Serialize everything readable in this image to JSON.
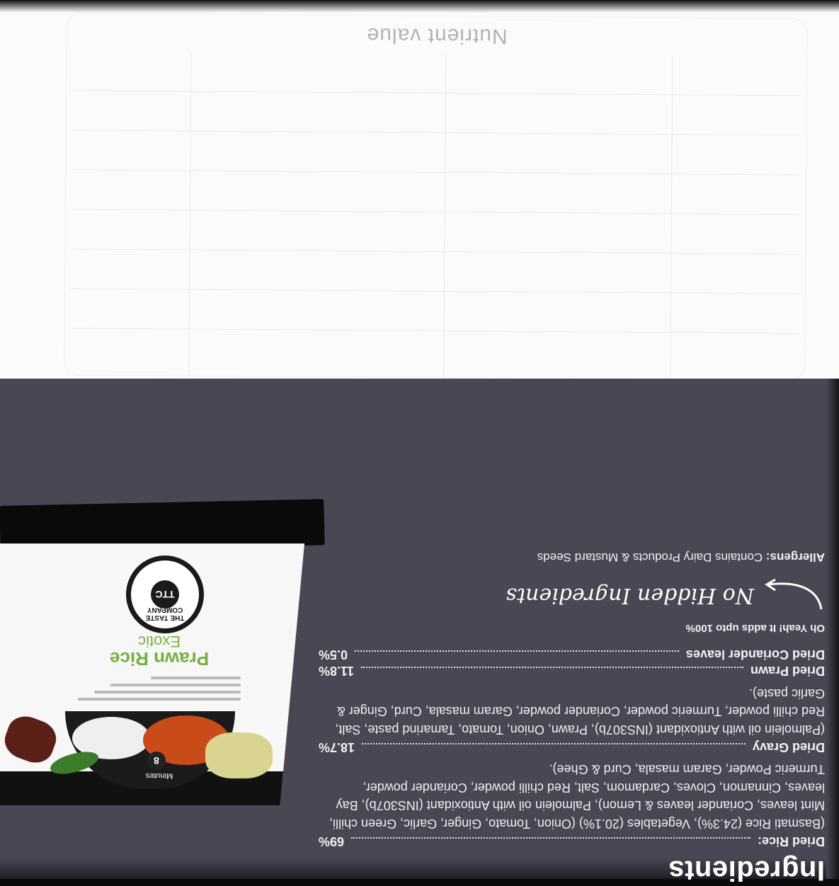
{
  "nutrition": {
    "title": "Nutrient value"
  },
  "ingredients": {
    "heading": "Ingredients",
    "items": [
      {
        "name": "Dried Rice:",
        "percent": "69%",
        "detail": "(Basmati Rice (24.3%), Vegetables (20.1%) (Onion, Tomato, Ginger, Garlic, Green chilli, Mint leaves, Coriander leaves & Lemon), Palmolein oil with Antioxidant (INS307b), Bay leaves, Cinnamon, Cloves, Cardamom, Salt, Red chilli powder, Coriander powder, Turmeric Powder, Garam masala, Curd & Ghee)."
      },
      {
        "name": "Dried Gravy",
        "percent": "18.7%",
        "detail": "(Palmolein oil with Antioxidant (INS307b), Prawn, Onion, Tomato, Tamarind paste, Salt, Red chilli powder, Turmeric powder, Coriander powder, Garam masala, Curd, Ginger & Garlic paste)."
      },
      {
        "name": "Dried Prawn",
        "percent": "11.8%",
        "detail": ""
      },
      {
        "name": "Dried Coriander leaves",
        "percent": "0.5%",
        "detail": ""
      }
    ],
    "note": "Oh Yeah! It adds upto 100%",
    "signature": "No Hidden Ingredients",
    "allergens_label": "Allergens:",
    "allergens_text": "Contains Dairy Products & Mustard Seeds"
  },
  "product": {
    "brand_badge": "TTC",
    "brand_name": "THE TASTE COMPANY",
    "title_line1": "Exotic",
    "title_line2": "Prawn Rice",
    "cook_time": "8",
    "cook_time_unit": "Minutes"
  },
  "colors": {
    "panel_background": "#4b4654",
    "card_background": "#fbfbfb",
    "product_title_green": "#76b041",
    "text_light": "#f3f0f6"
  }
}
